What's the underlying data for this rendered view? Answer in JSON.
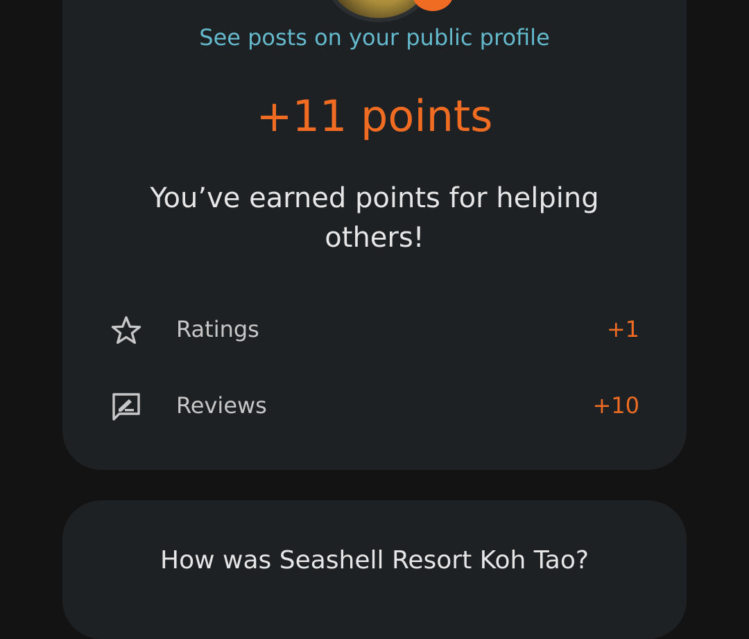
{
  "summary_card": {
    "profile_link": "See posts on your public profile",
    "points": "+11 points",
    "message": "You’ve earned points for helping others!",
    "badge_icon": "contributor-badge-icon",
    "rows": [
      {
        "label": "Ratings",
        "value": "+1",
        "icon": "star-outline-icon"
      },
      {
        "label": "Reviews",
        "value": "+10",
        "icon": "review-edit-icon"
      }
    ]
  },
  "next_card": {
    "question": "How was Seashell Resort Koh Tao?"
  },
  "colors": {
    "background": "#131313",
    "card": "#1d2124",
    "accent_orange": "#ef6c22",
    "link_teal": "#64b9cc",
    "text_primary": "#e6e6e6",
    "text_secondary": "#c7c7c7"
  }
}
